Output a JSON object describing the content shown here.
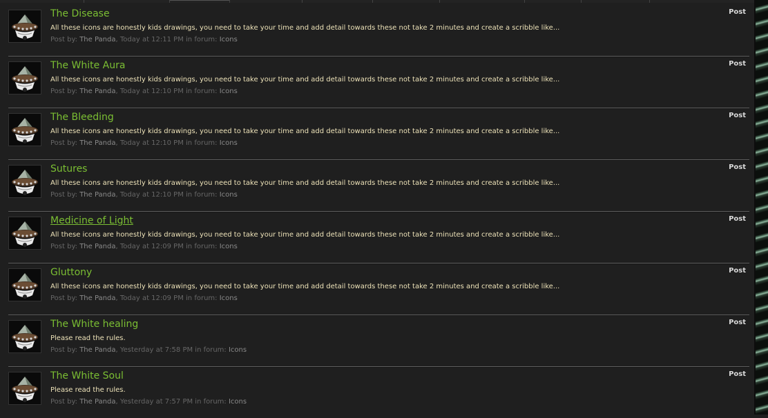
{
  "posts": [
    {
      "title": "The Disease",
      "excerpt": "All these icons are honestly kids drawings, you need to take your time and add detail towards these not take 2 minutes and create a scribble like...",
      "meta": {
        "posted_by_label": "Post by: ",
        "author": "The Panda",
        "sep": ", ",
        "time": "Today at 12:11 PM",
        "in_forum": " in forum: ",
        "forum": "Icons"
      },
      "type": "Post"
    },
    {
      "title": "The White Aura",
      "excerpt": "All these icons are honestly kids drawings, you need to take your time and add detail towards these not take 2 minutes and create a scribble like...",
      "meta": {
        "posted_by_label": "Post by: ",
        "author": "The Panda",
        "sep": ", ",
        "time": "Today at 12:10 PM",
        "in_forum": " in forum: ",
        "forum": "Icons"
      },
      "type": "Post"
    },
    {
      "title": "The Bleeding",
      "excerpt": "All these icons are honestly kids drawings, you need to take your time and add detail towards these not take 2 minutes and create a scribble like...",
      "meta": {
        "posted_by_label": "Post by: ",
        "author": "The Panda",
        "sep": ", ",
        "time": "Today at 12:10 PM",
        "in_forum": " in forum: ",
        "forum": "Icons"
      },
      "type": "Post"
    },
    {
      "title": "Sutures",
      "excerpt": "All these icons are honestly kids drawings, you need to take your time and add detail towards these not take 2 minutes and create a scribble like...",
      "meta": {
        "posted_by_label": "Post by: ",
        "author": "The Panda",
        "sep": ", ",
        "time": "Today at 12:10 PM",
        "in_forum": " in forum: ",
        "forum": "Icons"
      },
      "type": "Post"
    },
    {
      "title": "Medicine of Light",
      "excerpt": "All these icons are honestly kids drawings, you need to take your time and add detail towards these not take 2 minutes and create a scribble like...",
      "meta": {
        "posted_by_label": "Post by: ",
        "author": "The Panda",
        "sep": ", ",
        "time": "Today at 12:09 PM",
        "in_forum": " in forum: ",
        "forum": "Icons"
      },
      "type": "Post",
      "hovered": true
    },
    {
      "title": "Gluttony",
      "excerpt": "All these icons are honestly kids drawings, you need to take your time and add detail towards these not take 2 minutes and create a scribble like...",
      "meta": {
        "posted_by_label": "Post by: ",
        "author": "The Panda",
        "sep": ", ",
        "time": "Today at 12:09 PM",
        "in_forum": " in forum: ",
        "forum": "Icons"
      },
      "type": "Post"
    },
    {
      "title": "The White healing",
      "excerpt": "Please read the rules.",
      "meta": {
        "posted_by_label": "Post by: ",
        "author": "The Panda",
        "sep": ", ",
        "time": "Yesterday at 7:58 PM",
        "in_forum": " in forum: ",
        "forum": "Icons"
      },
      "type": "Post"
    },
    {
      "title": "The White Soul",
      "excerpt": "Please read the rules.",
      "meta": {
        "posted_by_label": "Post by: ",
        "author": "The Panda",
        "sep": ", ",
        "time": "Yesterday at 7:57 PM",
        "in_forum": " in forum: ",
        "forum": "Icons"
      },
      "type": "Post"
    }
  ],
  "avatar_icon": "warrior-helmet-icon",
  "colors": {
    "background": "#1f1f1f",
    "title": "#7bbf33",
    "excerpt": "#ede2b8",
    "meta": "#676767",
    "meta_link": "#8a8a8a",
    "post_type": "#d9d9d9",
    "divider": "#5f5f5f"
  }
}
